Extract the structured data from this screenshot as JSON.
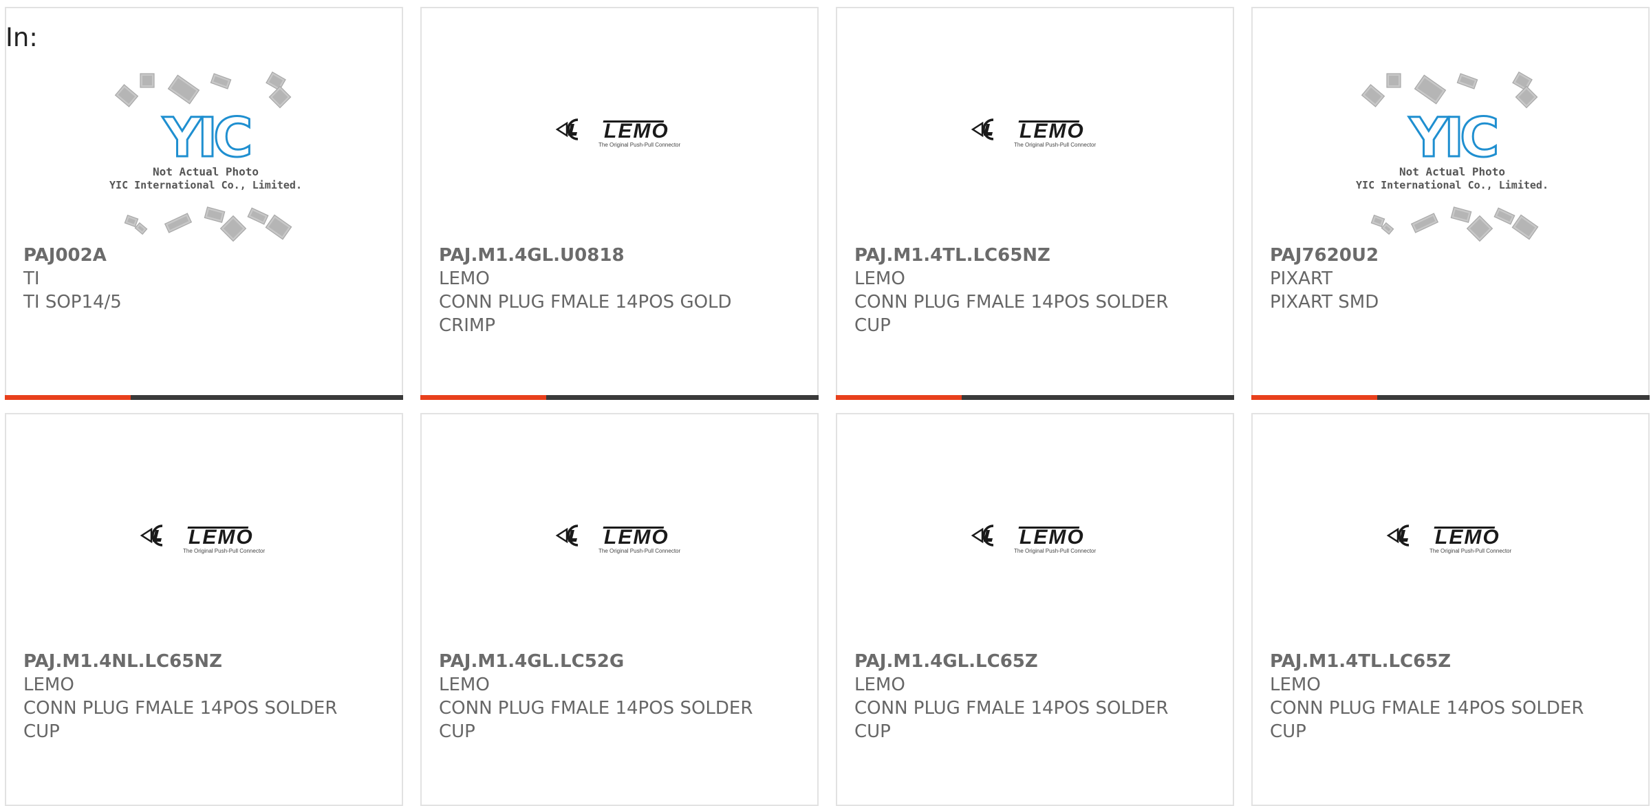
{
  "page": {
    "heading": "In:"
  },
  "colors": {
    "accent": "#e8401c",
    "bar": "#3a3a3a",
    "lemo": "#1a1a1a",
    "yic": "#1f8fd0"
  },
  "placeholder_image": {
    "line1": "Not Actual Photo",
    "line2": "YIC International Co., Limited.",
    "logo": "YIC"
  },
  "lemo_logo": {
    "wordmark": "LEMO",
    "tagline": "The Original Push-Pull Connector"
  },
  "products": [
    {
      "part": "PAJ002A",
      "mfr": "TI",
      "desc": "TI SOP14/5",
      "image": "yic-placeholder"
    },
    {
      "part": "PAJ.M1.4GL.U0818",
      "mfr": "LEMO",
      "desc": "CONN PLUG FMALE 14POS GOLD CRIMP",
      "image": "lemo-logo"
    },
    {
      "part": "PAJ.M1.4TL.LC65NZ",
      "mfr": "LEMO",
      "desc": "CONN PLUG FMALE 14POS SOLDER CUP",
      "image": "lemo-logo"
    },
    {
      "part": "PAJ7620U2",
      "mfr": "PIXART",
      "desc": "PIXART SMD",
      "image": "yic-placeholder"
    },
    {
      "part": "PAJ.M1.4NL.LC65NZ",
      "mfr": "LEMO",
      "desc": "CONN PLUG FMALE 14POS SOLDER CUP",
      "image": "lemo-logo"
    },
    {
      "part": "PAJ.M1.4GL.LC52G",
      "mfr": "LEMO",
      "desc": "CONN PLUG FMALE 14POS SOLDER CUP",
      "image": "lemo-logo"
    },
    {
      "part": "PAJ.M1.4GL.LC65Z",
      "mfr": "LEMO",
      "desc": "CONN PLUG FMALE 14POS SOLDER CUP",
      "image": "lemo-logo"
    },
    {
      "part": "PAJ.M1.4TL.LC65Z",
      "mfr": "LEMO",
      "desc": "CONN PLUG FMALE 14POS SOLDER CUP",
      "image": "lemo-logo"
    }
  ]
}
